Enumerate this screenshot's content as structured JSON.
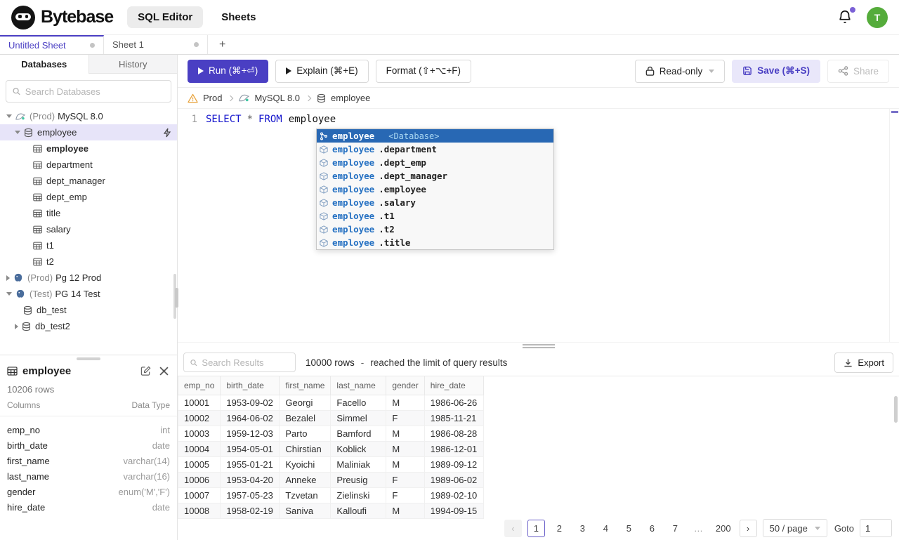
{
  "colors": {
    "accent_purple": "#4a3fc3",
    "save_bg": "#e9e7fa",
    "selection_blue": "#2868b4",
    "keyword_blue": "#1414cc",
    "avatar_green": "#55ac3b",
    "warning_amber": "#e8a33d",
    "selected_row_bg": "#e7e4f9"
  },
  "header": {
    "brand": "Bytebase",
    "nav_sql_editor": "SQL Editor",
    "nav_sheets": "Sheets",
    "avatar_letter": "T"
  },
  "sheet_tabs": {
    "active": "Untitled Sheet",
    "tab2": "Sheet 1",
    "add": "+"
  },
  "sidebar": {
    "tab_databases": "Databases",
    "tab_history": "History",
    "search_placeholder": "Search Databases",
    "tree": {
      "mysql": {
        "env": "(Prod)",
        "name": "MySQL 8.0"
      },
      "db_employee": "employee",
      "tables": [
        "employee",
        "department",
        "dept_manager",
        "dept_emp",
        "title",
        "salary",
        "t1",
        "t2"
      ],
      "pg12": {
        "env": "(Prod)",
        "name": "Pg 12 Prod"
      },
      "pg14": {
        "env": "(Test)",
        "name": "PG 14 Test"
      },
      "pg14_dbs": [
        "db_test",
        "db_test2"
      ]
    },
    "schema_panel": {
      "title": "employee",
      "row_count": "10206 rows",
      "col_header": "Columns",
      "type_header": "Data Type",
      "columns": [
        {
          "name": "emp_no",
          "type": "int"
        },
        {
          "name": "birth_date",
          "type": "date"
        },
        {
          "name": "first_name",
          "type": "varchar(14)"
        },
        {
          "name": "last_name",
          "type": "varchar(16)"
        },
        {
          "name": "gender",
          "type": "enum('M','F')"
        },
        {
          "name": "hire_date",
          "type": "date"
        }
      ]
    }
  },
  "toolbar": {
    "run": "Run (⌘+⏎)",
    "explain": "Explain (⌘+E)",
    "format": "Format (⇧+⌥+F)",
    "readonly": "Read-only",
    "save": "Save (⌘+S)",
    "share": "Share"
  },
  "breadcrumb": {
    "env": "Prod",
    "instance": "MySQL 8.0",
    "database": "employee"
  },
  "editor": {
    "line_number": "1",
    "kw_select": "SELECT",
    "star": "*",
    "kw_from": "FROM",
    "table": "employee"
  },
  "autocomplete": {
    "selected_name": "employee",
    "selected_detail": "<Database>",
    "prefix": "employee",
    "items": [
      ".department",
      ".dept_emp",
      ".dept_manager",
      ".employee",
      ".salary",
      ".t1",
      ".t2",
      ".title"
    ]
  },
  "results": {
    "search_placeholder": "Search Results",
    "row_count": "10000 rows",
    "dash": "-",
    "limit_note": "reached the limit of query results",
    "export": "Export",
    "table": {
      "headers": [
        "emp_no",
        "birth_date",
        "first_name",
        "last_name",
        "gender",
        "hire_date"
      ],
      "rows": [
        [
          "10001",
          "1953-09-02",
          "Georgi",
          "Facello",
          "M",
          "1986-06-26"
        ],
        [
          "10002",
          "1964-06-02",
          "Bezalel",
          "Simmel",
          "F",
          "1985-11-21"
        ],
        [
          "10003",
          "1959-12-03",
          "Parto",
          "Bamford",
          "M",
          "1986-08-28"
        ],
        [
          "10004",
          "1954-05-01",
          "Chirstian",
          "Koblick",
          "M",
          "1986-12-01"
        ],
        [
          "10005",
          "1955-01-21",
          "Kyoichi",
          "Maliniak",
          "M",
          "1989-09-12"
        ],
        [
          "10006",
          "1953-04-20",
          "Anneke",
          "Preusig",
          "F",
          "1989-06-02"
        ],
        [
          "10007",
          "1957-05-23",
          "Tzvetan",
          "Zielinski",
          "F",
          "1989-02-10"
        ],
        [
          "10008",
          "1958-02-19",
          "Saniva",
          "Kalloufi",
          "M",
          "1994-09-15"
        ]
      ]
    },
    "pagination": {
      "prev": "‹",
      "next": "›",
      "pages": [
        "1",
        "2",
        "3",
        "4",
        "5",
        "6",
        "7",
        "…",
        "200"
      ],
      "page_size": "50 / page",
      "goto_label": "Goto",
      "goto_value": "1"
    }
  }
}
